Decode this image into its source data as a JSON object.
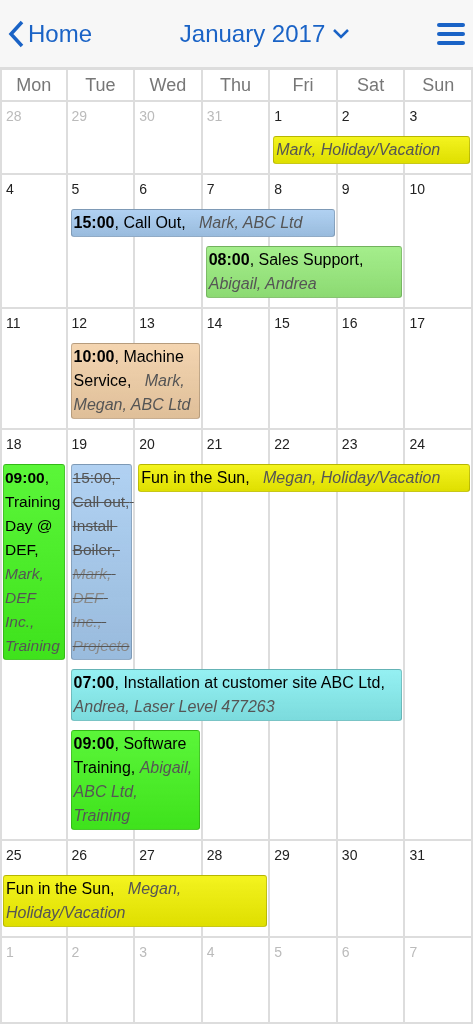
{
  "header": {
    "back_label": "Home",
    "title": "January 2017"
  },
  "weekdays": [
    "Mon",
    "Tue",
    "Wed",
    "Thu",
    "Fri",
    "Sat",
    "Sun"
  ],
  "weeks": [
    {
      "days": [
        {
          "number": "28",
          "outside": true
        },
        {
          "number": "29",
          "outside": true
        },
        {
          "number": "30",
          "outside": true
        },
        {
          "number": "31",
          "outside": true
        },
        {
          "number": "1",
          "outside": false
        },
        {
          "number": "2",
          "outside": false
        },
        {
          "number": "3",
          "outside": false
        }
      ],
      "events": [
        {
          "color": "#f2f200",
          "cancelled": false,
          "text": "*Mark, Holiday/Vacation*"
        }
      ]
    },
    {
      "days": [
        {
          "number": "4",
          "outside": false
        },
        {
          "number": "5",
          "outside": false
        },
        {
          "number": "6",
          "outside": false
        },
        {
          "number": "7",
          "outside": false
        },
        {
          "number": "8",
          "outside": false
        },
        {
          "number": "9",
          "outside": false
        },
        {
          "number": "10",
          "outside": false
        }
      ],
      "events": [
        {
          "color": "#a6cbf0",
          "cancelled": false,
          "text": "**15:00**, Call Out,   *Mark, ABC Ltd*"
        },
        {
          "color": "#98ec7c",
          "cancelled": false,
          "text": "**08:00**, Sales Support, *Abigail, Andrea*"
        }
      ]
    },
    {
      "days": [
        {
          "number": "11",
          "outside": false
        },
        {
          "number": "12",
          "outside": false
        },
        {
          "number": "13",
          "outside": false
        },
        {
          "number": "14",
          "outside": false
        },
        {
          "number": "15",
          "outside": false
        },
        {
          "number": "16",
          "outside": false
        },
        {
          "number": "17",
          "outside": false
        }
      ],
      "events": [
        {
          "color": "#f2cfa6",
          "cancelled": false,
          "text": "**10:00**, Machine Service,   *Mark, Megan, ABC Ltd*"
        }
      ]
    },
    {
      "days": [
        {
          "number": "18",
          "outside": false
        },
        {
          "number": "19",
          "outside": false
        },
        {
          "number": "20",
          "outside": false
        },
        {
          "number": "21",
          "outside": false
        },
        {
          "number": "22",
          "outside": false
        },
        {
          "number": "23",
          "outside": false
        },
        {
          "number": "24",
          "outside": false
        }
      ],
      "events": [
        {
          "color": "#44f51e",
          "cancelled": false,
          "text": "**09:00**, Training Day @ DEF, *Mark, DEF Inc., Training*"
        },
        {
          "color": "#a6cbf0",
          "cancelled": true,
          "text": "15:00, Call out, Install Boiler, *Mark, DEF Inc., Projecto*"
        },
        {
          "color": "#f2f200",
          "cancelled": false,
          "text": "Fun in the Sun,   *Megan, Holiday/Vacation*"
        },
        {
          "color": "#86eef0",
          "cancelled": false,
          "text": "**07:00**, Installation at customer site ABC Ltd, *Andrea, Laser Level 477263*"
        },
        {
          "color": "#44f51e",
          "cancelled": false,
          "text": "**09:00**, Software Training, *Abigail, ABC Ltd, Training*"
        }
      ]
    },
    {
      "days": [
        {
          "number": "25",
          "outside": false
        },
        {
          "number": "26",
          "outside": false
        },
        {
          "number": "27",
          "outside": false
        },
        {
          "number": "28",
          "outside": false
        },
        {
          "number": "29",
          "outside": false
        },
        {
          "number": "30",
          "outside": false
        },
        {
          "number": "31",
          "outside": false
        }
      ],
      "events": [
        {
          "color": "#f2f200",
          "cancelled": false,
          "text": "Fun in the Sun,   *Megan, Holiday/Vacation*"
        }
      ]
    },
    {
      "days": [
        {
          "number": "1",
          "outside": true
        },
        {
          "number": "2",
          "outside": true
        },
        {
          "number": "3",
          "outside": true
        },
        {
          "number": "4",
          "outside": true
        },
        {
          "number": "5",
          "outside": true
        },
        {
          "number": "6",
          "outside": true
        },
        {
          "number": "7",
          "outside": true
        }
      ]
    }
  ]
}
